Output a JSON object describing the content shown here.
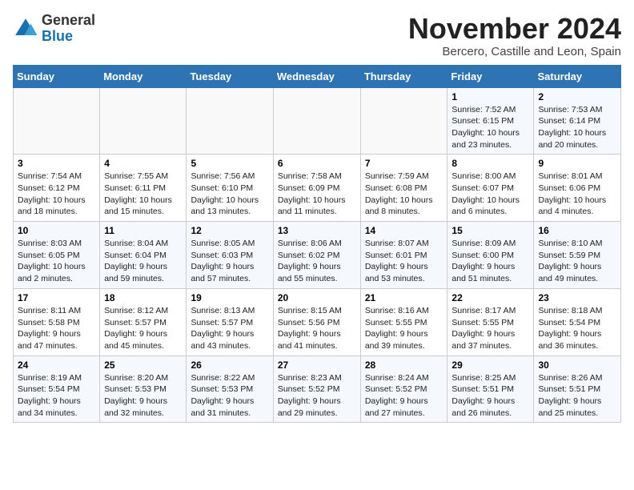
{
  "logo": {
    "general": "General",
    "blue": "Blue"
  },
  "header": {
    "month": "November 2024",
    "location": "Bercero, Castille and Leon, Spain"
  },
  "weekdays": [
    "Sunday",
    "Monday",
    "Tuesday",
    "Wednesday",
    "Thursday",
    "Friday",
    "Saturday"
  ],
  "weeks": [
    [
      {
        "day": "",
        "info": ""
      },
      {
        "day": "",
        "info": ""
      },
      {
        "day": "",
        "info": ""
      },
      {
        "day": "",
        "info": ""
      },
      {
        "day": "",
        "info": ""
      },
      {
        "day": "1",
        "info": "Sunrise: 7:52 AM\nSunset: 6:15 PM\nDaylight: 10 hours and 23 minutes."
      },
      {
        "day": "2",
        "info": "Sunrise: 7:53 AM\nSunset: 6:14 PM\nDaylight: 10 hours and 20 minutes."
      }
    ],
    [
      {
        "day": "3",
        "info": "Sunrise: 7:54 AM\nSunset: 6:12 PM\nDaylight: 10 hours and 18 minutes."
      },
      {
        "day": "4",
        "info": "Sunrise: 7:55 AM\nSunset: 6:11 PM\nDaylight: 10 hours and 15 minutes."
      },
      {
        "day": "5",
        "info": "Sunrise: 7:56 AM\nSunset: 6:10 PM\nDaylight: 10 hours and 13 minutes."
      },
      {
        "day": "6",
        "info": "Sunrise: 7:58 AM\nSunset: 6:09 PM\nDaylight: 10 hours and 11 minutes."
      },
      {
        "day": "7",
        "info": "Sunrise: 7:59 AM\nSunset: 6:08 PM\nDaylight: 10 hours and 8 minutes."
      },
      {
        "day": "8",
        "info": "Sunrise: 8:00 AM\nSunset: 6:07 PM\nDaylight: 10 hours and 6 minutes."
      },
      {
        "day": "9",
        "info": "Sunrise: 8:01 AM\nSunset: 6:06 PM\nDaylight: 10 hours and 4 minutes."
      }
    ],
    [
      {
        "day": "10",
        "info": "Sunrise: 8:03 AM\nSunset: 6:05 PM\nDaylight: 10 hours and 2 minutes."
      },
      {
        "day": "11",
        "info": "Sunrise: 8:04 AM\nSunset: 6:04 PM\nDaylight: 9 hours and 59 minutes."
      },
      {
        "day": "12",
        "info": "Sunrise: 8:05 AM\nSunset: 6:03 PM\nDaylight: 9 hours and 57 minutes."
      },
      {
        "day": "13",
        "info": "Sunrise: 8:06 AM\nSunset: 6:02 PM\nDaylight: 9 hours and 55 minutes."
      },
      {
        "day": "14",
        "info": "Sunrise: 8:07 AM\nSunset: 6:01 PM\nDaylight: 9 hours and 53 minutes."
      },
      {
        "day": "15",
        "info": "Sunrise: 8:09 AM\nSunset: 6:00 PM\nDaylight: 9 hours and 51 minutes."
      },
      {
        "day": "16",
        "info": "Sunrise: 8:10 AM\nSunset: 5:59 PM\nDaylight: 9 hours and 49 minutes."
      }
    ],
    [
      {
        "day": "17",
        "info": "Sunrise: 8:11 AM\nSunset: 5:58 PM\nDaylight: 9 hours and 47 minutes."
      },
      {
        "day": "18",
        "info": "Sunrise: 8:12 AM\nSunset: 5:57 PM\nDaylight: 9 hours and 45 minutes."
      },
      {
        "day": "19",
        "info": "Sunrise: 8:13 AM\nSunset: 5:57 PM\nDaylight: 9 hours and 43 minutes."
      },
      {
        "day": "20",
        "info": "Sunrise: 8:15 AM\nSunset: 5:56 PM\nDaylight: 9 hours and 41 minutes."
      },
      {
        "day": "21",
        "info": "Sunrise: 8:16 AM\nSunset: 5:55 PM\nDaylight: 9 hours and 39 minutes."
      },
      {
        "day": "22",
        "info": "Sunrise: 8:17 AM\nSunset: 5:55 PM\nDaylight: 9 hours and 37 minutes."
      },
      {
        "day": "23",
        "info": "Sunrise: 8:18 AM\nSunset: 5:54 PM\nDaylight: 9 hours and 36 minutes."
      }
    ],
    [
      {
        "day": "24",
        "info": "Sunrise: 8:19 AM\nSunset: 5:54 PM\nDaylight: 9 hours and 34 minutes."
      },
      {
        "day": "25",
        "info": "Sunrise: 8:20 AM\nSunset: 5:53 PM\nDaylight: 9 hours and 32 minutes."
      },
      {
        "day": "26",
        "info": "Sunrise: 8:22 AM\nSunset: 5:53 PM\nDaylight: 9 hours and 31 minutes."
      },
      {
        "day": "27",
        "info": "Sunrise: 8:23 AM\nSunset: 5:52 PM\nDaylight: 9 hours and 29 minutes."
      },
      {
        "day": "28",
        "info": "Sunrise: 8:24 AM\nSunset: 5:52 PM\nDaylight: 9 hours and 27 minutes."
      },
      {
        "day": "29",
        "info": "Sunrise: 8:25 AM\nSunset: 5:51 PM\nDaylight: 9 hours and 26 minutes."
      },
      {
        "day": "30",
        "info": "Sunrise: 8:26 AM\nSunset: 5:51 PM\nDaylight: 9 hours and 25 minutes."
      }
    ]
  ]
}
